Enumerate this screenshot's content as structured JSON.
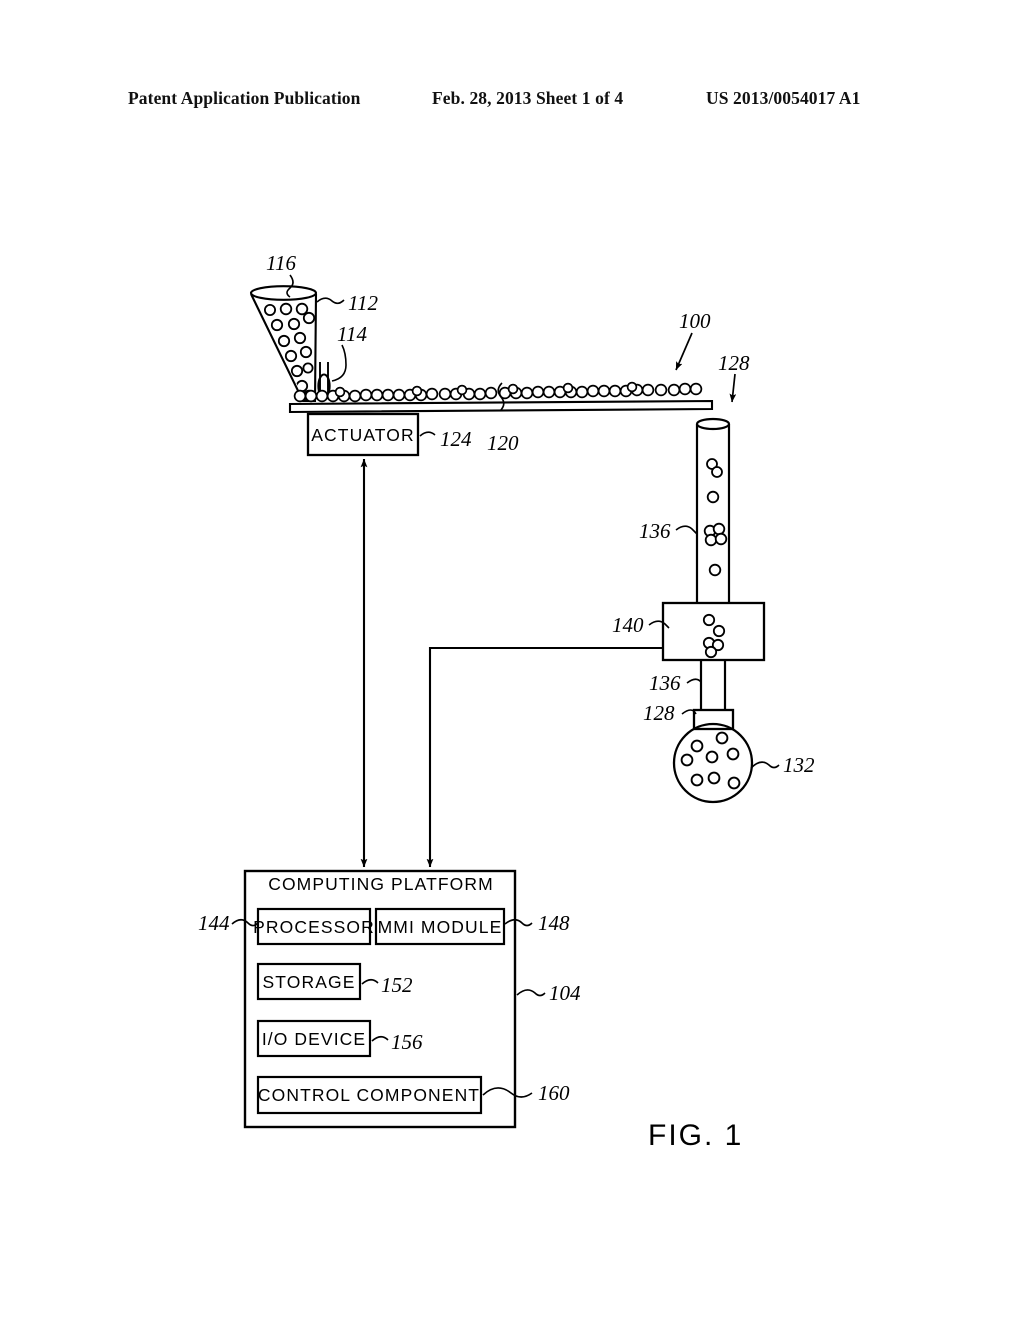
{
  "header": {
    "left": "Patent Application Publication",
    "middle": "Feb. 28, 2013  Sheet 1 of 4",
    "right": "US 2013/0054017 A1"
  },
  "figure": {
    "caption": "FIG. 1",
    "boxes": {
      "actuator": "ACTUATOR",
      "computing_platform": "COMPUTING PLATFORM",
      "processor": "PROCESSOR",
      "mmi_module": "MMI MODULE",
      "storage": "STORAGE",
      "io_device": "I/O DEVICE",
      "control_component": "CONTROL COMPONENT"
    },
    "reference_numerals": {
      "n100": "100",
      "n104": "104",
      "n112": "112",
      "n114": "114",
      "n116": "116",
      "n120": "120",
      "n124": "124",
      "n128_top": "128",
      "n128_bottom": "128",
      "n132": "132",
      "n136_upper": "136",
      "n136_lower": "136",
      "n140": "140",
      "n144": "144",
      "n148": "148",
      "n152": "152",
      "n156": "156",
      "n160": "160"
    }
  }
}
